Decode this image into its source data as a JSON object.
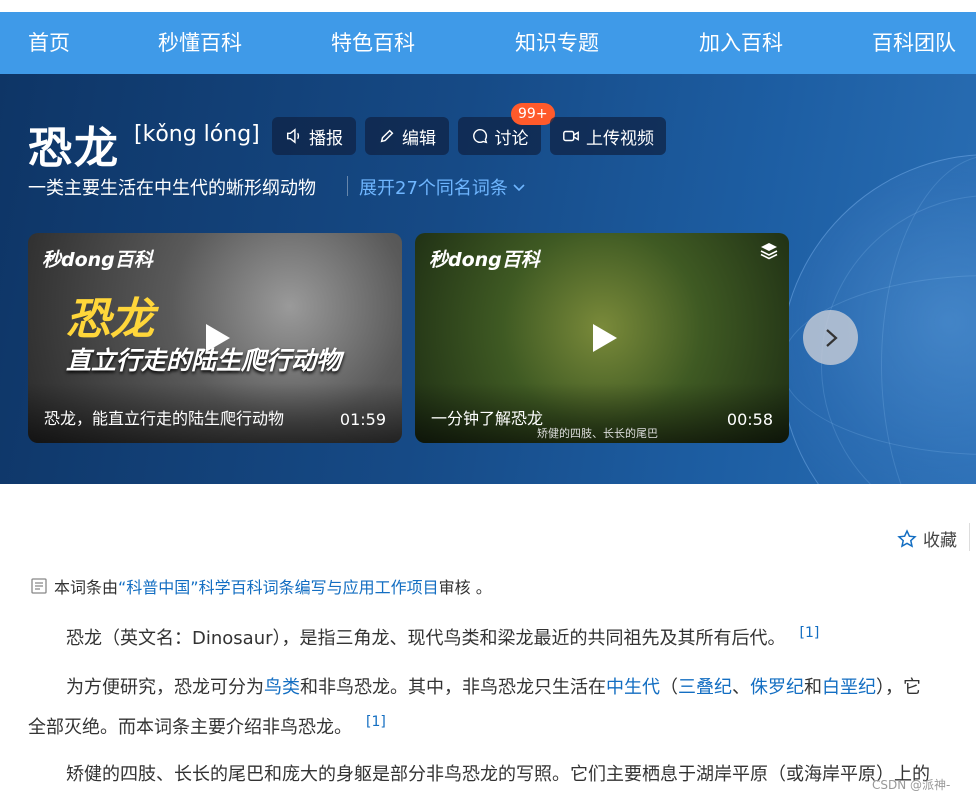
{
  "nav": {
    "items": [
      "首页",
      "秒懂百科",
      "特色百科",
      "知识专题",
      "加入百科",
      "百科团队"
    ]
  },
  "entry": {
    "title": "恐龙",
    "pinyin": "[kǒng lóng]",
    "subtitle": "一类主要生活在中生代的蜥形纲动物",
    "expand_label": "展开27个同名词条"
  },
  "actions": {
    "play": "播报",
    "edit": "编辑",
    "discuss": "讨论",
    "discuss_badge": "99+",
    "upload": "上传视频"
  },
  "videos": [
    {
      "brand": "秒dong百科",
      "overlay_title": "恐龙",
      "overlay_subtitle": "直立行走的陆生爬行动物",
      "caption": "恐龙，能直立行走的陆生爬行动物",
      "duration": "01:59"
    },
    {
      "brand": "秒dong百科",
      "caption": "一分钟了解恐龙",
      "subtitle_text": "矫健的四肢、长长的尾巴",
      "duration": "00:58"
    }
  ],
  "toolbar": {
    "collect_label": "收藏"
  },
  "review": {
    "prefix": "本词条由",
    "org": "“科普中国”科学百科词条编写与应用工作项目",
    "suffix": " 审核 。"
  },
  "paragraphs": {
    "p1_text": "恐龙（英文名：Dinosaur），是指三角龙、现代鸟类和梁龙最近的共同祖先及其所有后代。",
    "p1_ref": "[1]",
    "p2_a": "为方便研究，恐龙可分为",
    "p2_link_bird": "鸟类",
    "p2_b": "和非鸟恐龙。其中，非鸟恐龙只生活在",
    "p2_link_mesozoic": "中生代",
    "p2_c": "（",
    "p2_link_triassic": "三叠纪",
    "p2_d": "、",
    "p2_link_jurassic": "侏罗纪",
    "p2_e": "和",
    "p2_link_cretaceous": "白垩纪",
    "p2_f": "），它",
    "p2_line2": "全部灭绝。而本词条主要介绍非鸟恐龙。",
    "p2_ref": "[1]",
    "p3_text": "矫健的四肢、长长的尾巴和庞大的身躯是部分非鸟恐龙的写照。它们主要栖息于湖岸平原（或海岸平原）上的"
  },
  "watermark": "CSDN @派神-",
  "colors": {
    "nav_bg": "#3f9ae8",
    "link": "#136ec2",
    "badge": "#ff5a2b",
    "expand": "#6fb6ff"
  }
}
